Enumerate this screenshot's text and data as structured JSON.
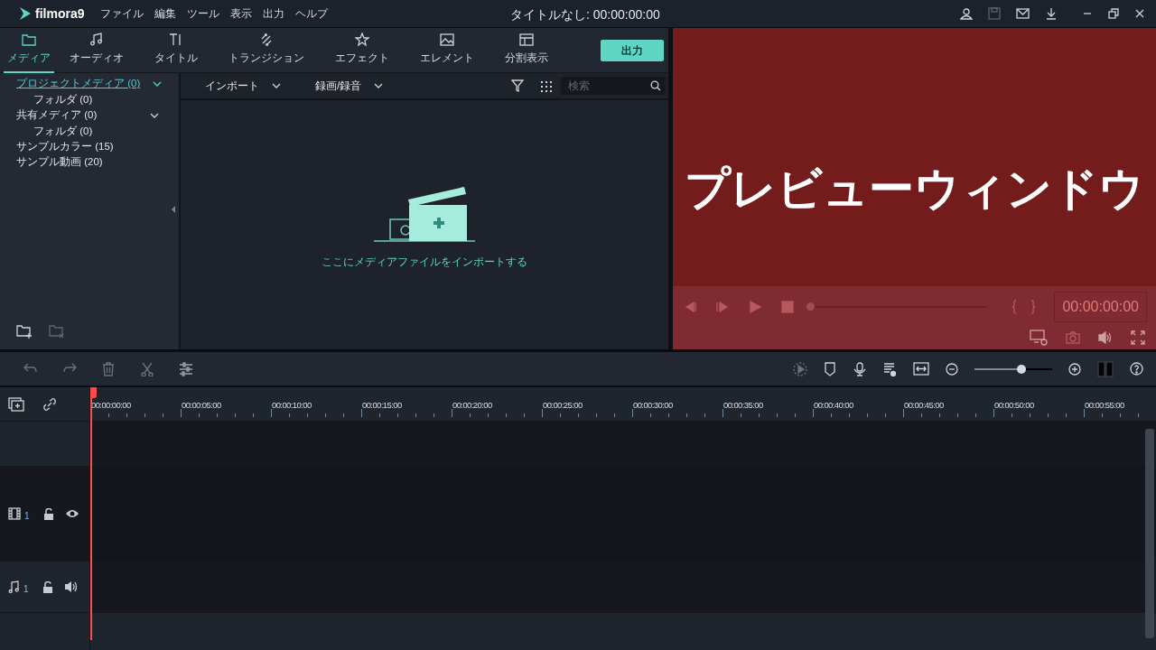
{
  "app": {
    "logo": "filmora9"
  },
  "menu": [
    "ファイル",
    "編集",
    "ツール",
    "表示",
    "出力",
    "ヘルプ"
  ],
  "window": {
    "title": "タイトルなし: 00:00:00:00"
  },
  "tabs": [
    {
      "label": "メディア",
      "selected": true
    },
    {
      "label": "オーディオ",
      "selected": false
    },
    {
      "label": "タイトル",
      "selected": false
    },
    {
      "label": "トランジション",
      "selected": false
    },
    {
      "label": "エフェクト",
      "selected": false
    },
    {
      "label": "エレメント",
      "selected": false
    },
    {
      "label": "分割表示",
      "selected": false
    }
  ],
  "export_button": "出力",
  "library": [
    {
      "label": "プロジェクトメディア (0)",
      "selected": true,
      "children": [
        {
          "label": "フォルダ (0)",
          "selected": false
        }
      ]
    },
    {
      "label": "共有メディア (0)",
      "selected": false,
      "children": [
        {
          "label": "フォルダ (0)",
          "selected": false
        }
      ]
    },
    {
      "label": "サンプルカラー (15)",
      "selected": false
    },
    {
      "label": "サンプル動画 (20)",
      "selected": false
    }
  ],
  "media_toolbar": {
    "import": "インポート",
    "record": "録画/録音",
    "search": {
      "placeholder": "検索"
    }
  },
  "empty_hint": "ここにメディアファイルをインポートする",
  "preview": {
    "caption": "プレビューウィンドウ",
    "timecode": "00:00:00:00",
    "progress": {
      "level": 0
    }
  },
  "zoom": {
    "level": 0.6
  },
  "ruler": [
    "00:00:00:00",
    "00:00:05:00",
    "00:00:10:00",
    "00:00:15:00",
    "00:00:20:00",
    "00:00:25:00",
    "00:00:30:00",
    "00:00:35:00",
    "00:00:40:00",
    "00:00:45:00",
    "00:00:50:00",
    "00:00:55:00"
  ],
  "tracks": [
    {
      "kind": "video",
      "number": "1"
    },
    {
      "kind": "audio",
      "number": "1"
    }
  ]
}
